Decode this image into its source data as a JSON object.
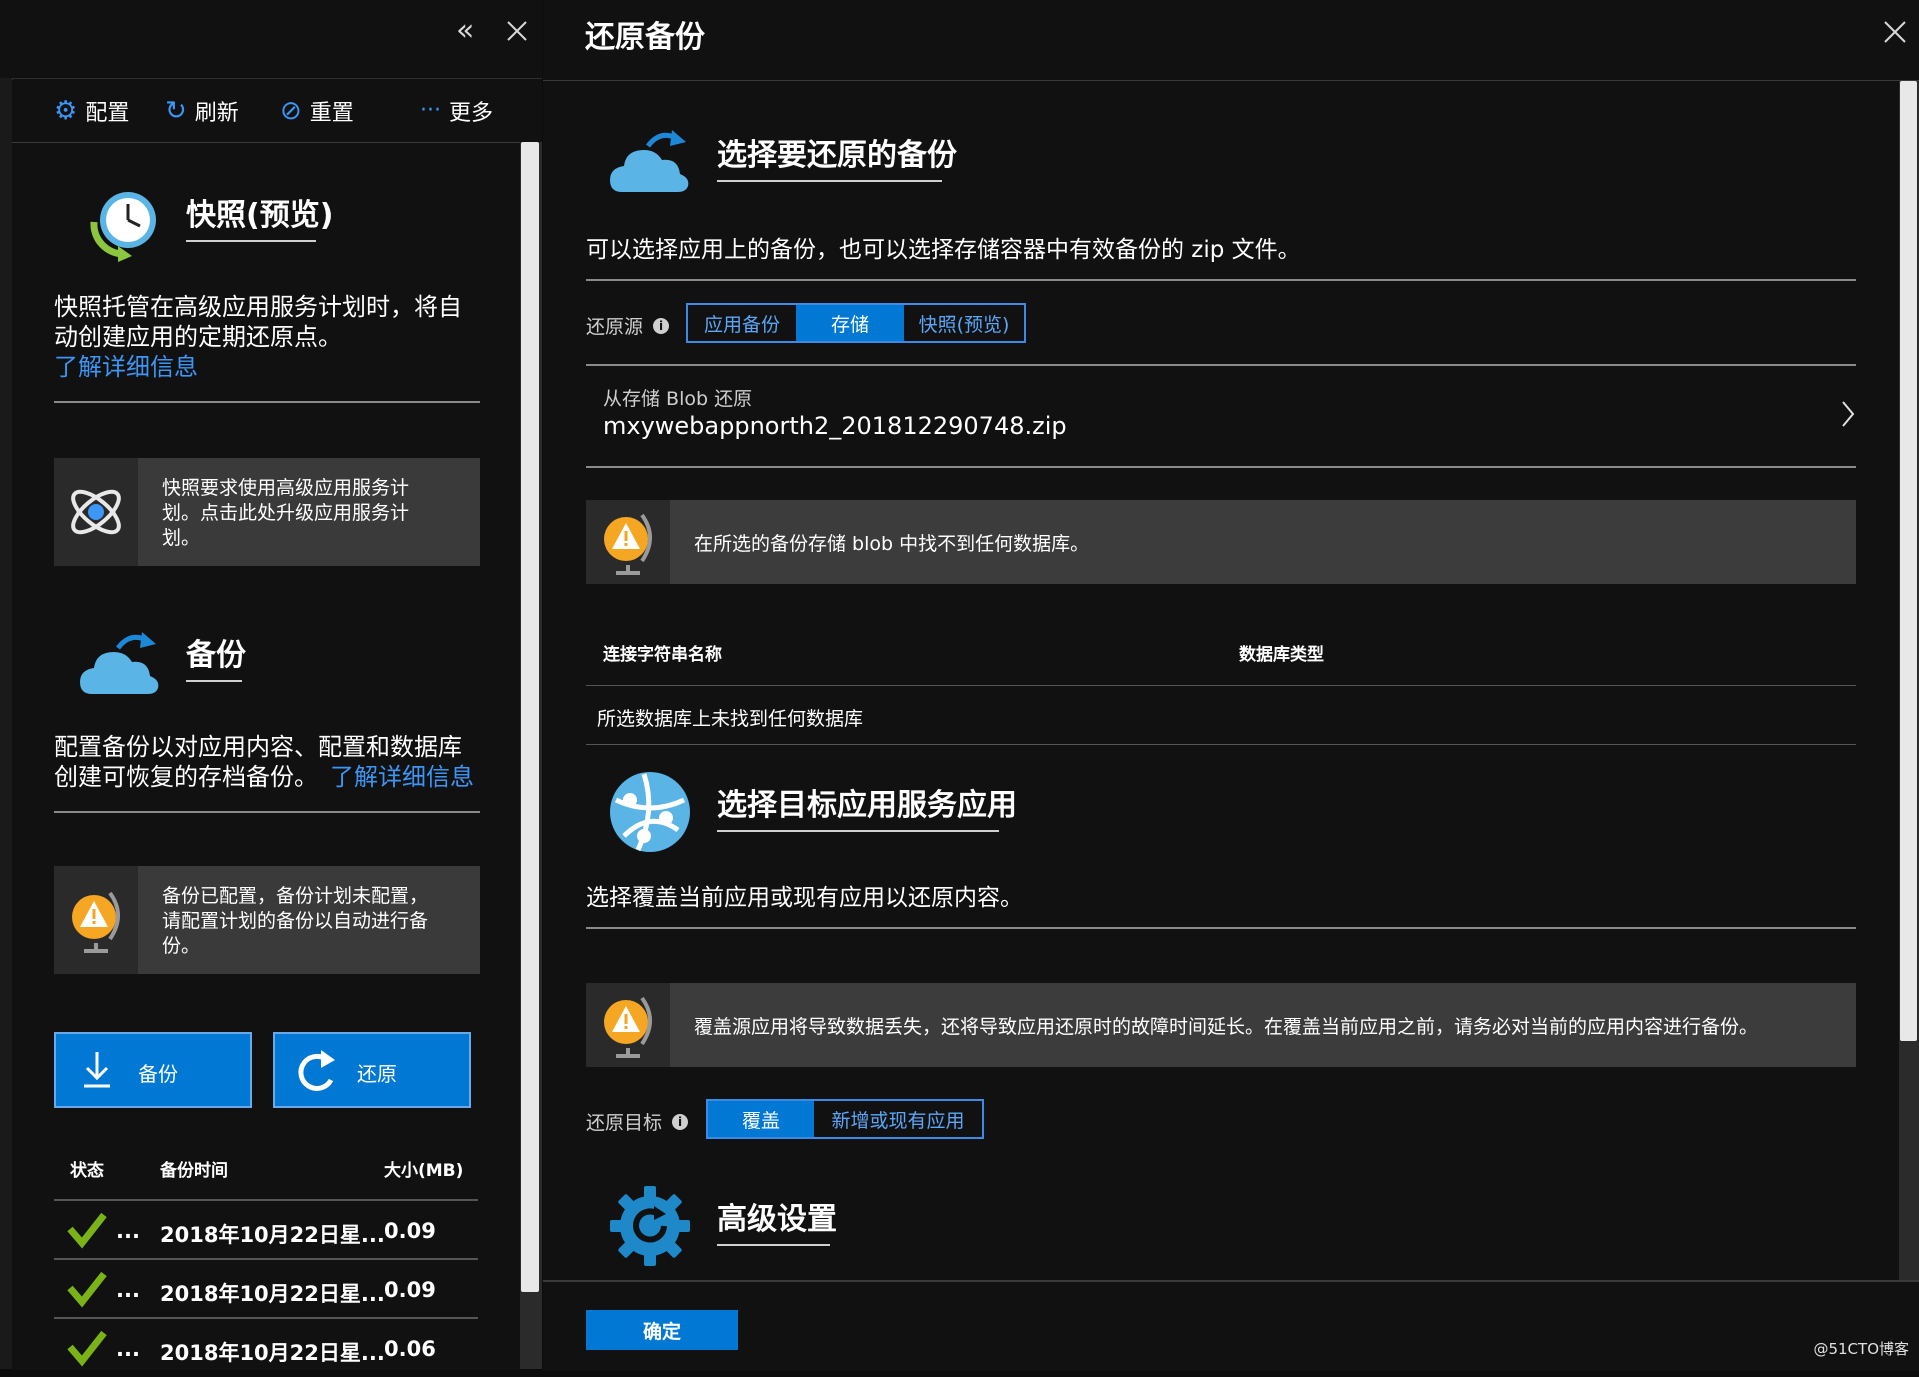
{
  "left": {
    "toolbar": {
      "config": "配置",
      "refresh": "刷新",
      "reset": "重置",
      "more": "更多"
    },
    "snapshot": {
      "title": "快照(预览)",
      "desc_line1": "快照托管在高级应用服务计划时，将自",
      "desc_line2": "动创建应用的定期还原点。",
      "learn_more": "了解详细信息",
      "info_line1": "快照要求使用高级应用服务计",
      "info_line2": "划。点击此处升级应用服务计",
      "info_line3": "划。"
    },
    "backup": {
      "title": "备份",
      "desc_line1": "配置备份以对应用内容、配置和数据库",
      "desc_line2": "创建可恢复的存档备份。",
      "learn_more": "了解详细信息",
      "info_line1": "备份已配置，备份计划未配置，",
      "info_line2": "请配置计划的备份以自动进行备",
      "info_line3": "份。",
      "backup_button": "备份",
      "restore_button": "还原"
    },
    "table": {
      "headers": [
        "状态",
        "备份时间",
        "大小(MB)"
      ],
      "rows": [
        {
          "status": "...",
          "time": "2018年10月22日星...",
          "size": "0.09"
        },
        {
          "status": "...",
          "time": "2018年10月22日星...",
          "size": "0.09"
        },
        {
          "status": "...",
          "time": "2018年10月22日星...",
          "size": "0.06"
        }
      ]
    }
  },
  "right": {
    "title": "还原备份",
    "select_backup": {
      "title": "选择要还原的备份",
      "desc": "可以选择应用上的备份，也可以选择存储容器中有效备份的 zip 文件。",
      "source_label": "还原源",
      "source_options": [
        "应用备份",
        "存储",
        "快照(预览)"
      ],
      "blob_label": "从存储 Blob 还原",
      "blob_value": "mxywebappnorth2_201812290748.zip",
      "warning": "在所选的备份存储 blob 中找不到任何数据库。",
      "db_headers": [
        "连接字符串名称",
        "数据库类型"
      ],
      "db_empty": "所选数据库上未找到任何数据库"
    },
    "select_target": {
      "title": "选择目标应用服务应用",
      "desc": "选择覆盖当前应用或现有应用以还原内容。",
      "warning": "覆盖源应用将导致数据丢失，还将导致应用还原时的故障时间延长。在覆盖当前应用之前，请务必对当前的应用内容进行备份。",
      "target_label": "还原目标",
      "target_options": [
        "覆盖",
        "新增或现有应用"
      ]
    },
    "advanced": {
      "title": "高级设置"
    },
    "ok_button": "确定"
  },
  "watermark": "@51CTO博客",
  "colors": {
    "accent": "#0078d4",
    "link": "#3b96f5",
    "warning": "#f5a623",
    "success": "#7ab317"
  }
}
